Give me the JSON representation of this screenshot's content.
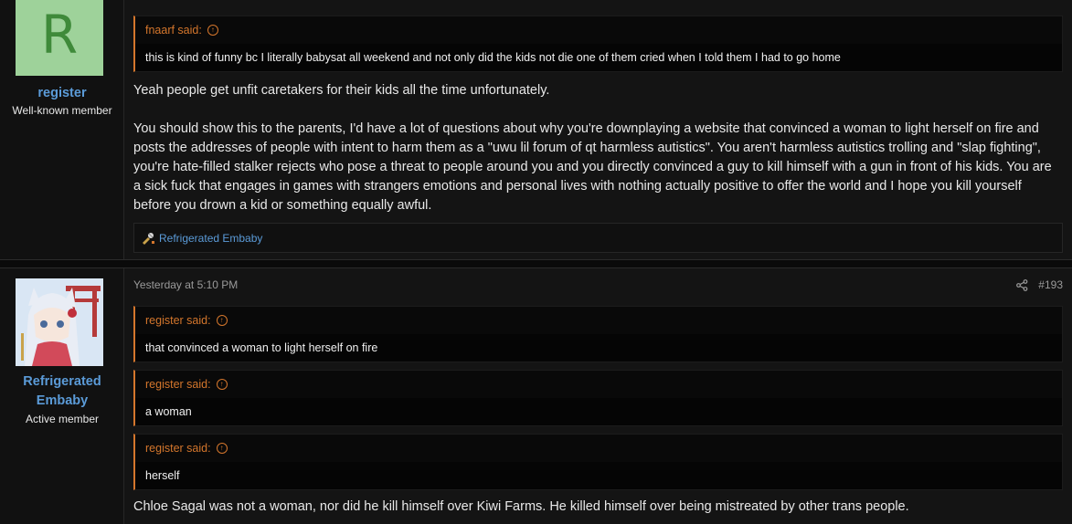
{
  "post1": {
    "avatar_letter": "R",
    "username": "register",
    "user_title": "Well-known member",
    "quote": {
      "author_label": "fnaarf said:",
      "text": "this is kind of funny bc I literally babysat all weekend and not only did the kids not die one of them cried when I told them I had to go home"
    },
    "message_p1": "Yeah people get unfit caretakers for their kids all the time unfortunately.",
    "message_p2": "You should show this to the parents, I'd have a lot of questions about why you're downplaying a website that convinced a woman to light herself on fire and posts the addresses of people with intent to harm them as a \"uwu lil forum of qt harmless autistics\". You aren't harmless autistics trolling and \"slap fighting\", you're hate-filled stalker rejects who pose a threat to people around you and you directly convinced a guy to kill himself with a gun in front of his kids. You are a sick fuck that engages in games with strangers emotions and personal lives with nothing actually positive to offer the world and I hope you kill yourself before you drown a kid or something equally awful.",
    "reaction_user": "Refrigerated Embaby"
  },
  "post2": {
    "username_line1": "Refrigerated",
    "username_line2": "Embaby",
    "user_title": "Active member",
    "date": "Yesterday at 5:10 PM",
    "post_number": "#193",
    "quotes": [
      {
        "author_label": "register said:",
        "text": "that convinced a woman to light herself on fire"
      },
      {
        "author_label": "register said:",
        "text": "a woman"
      },
      {
        "author_label": "register said:",
        "text": "herself"
      }
    ],
    "message": "Chloe Sagal was not a woman, nor did he kill himself over Kiwi Farms. He killed himself over being mistreated by other trans people."
  },
  "icons": {
    "quote_arrow": "circle-up-arrow-icon",
    "share": "share-icon",
    "reaction": "reaction-emoji-icon"
  },
  "colors": {
    "quote_accent": "#d4762c",
    "username_link": "#5b9bd8",
    "avatar_bg": "#9ed29a",
    "avatar_letter": "#3f8a3a"
  }
}
